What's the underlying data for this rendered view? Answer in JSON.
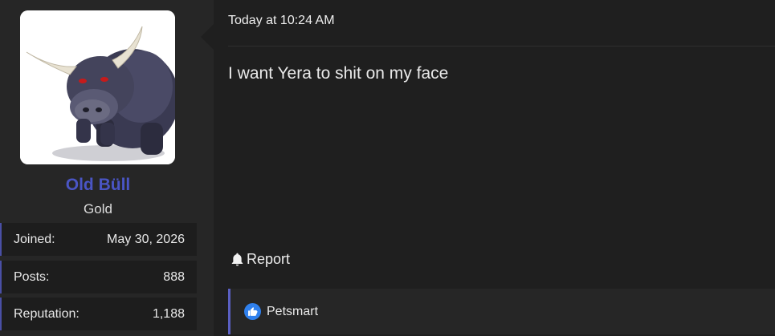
{
  "user": {
    "name": "Old Büll",
    "title": "Gold",
    "name_color": "#4a55c4",
    "stats": [
      {
        "label": "Joined:",
        "value": "May 30, 2026"
      },
      {
        "label": "Posts:",
        "value": "888"
      },
      {
        "label": "Reputation:",
        "value": "1,188"
      }
    ]
  },
  "post": {
    "timestamp": "Today at 10:24 AM",
    "message": "I want Yera to shit on my face",
    "report_label": "Report",
    "report_icon": "bell-icon"
  },
  "reactions": {
    "icon": "thumbs-up-icon",
    "icon_color": "#2f80ed",
    "users": "Petsmart"
  }
}
